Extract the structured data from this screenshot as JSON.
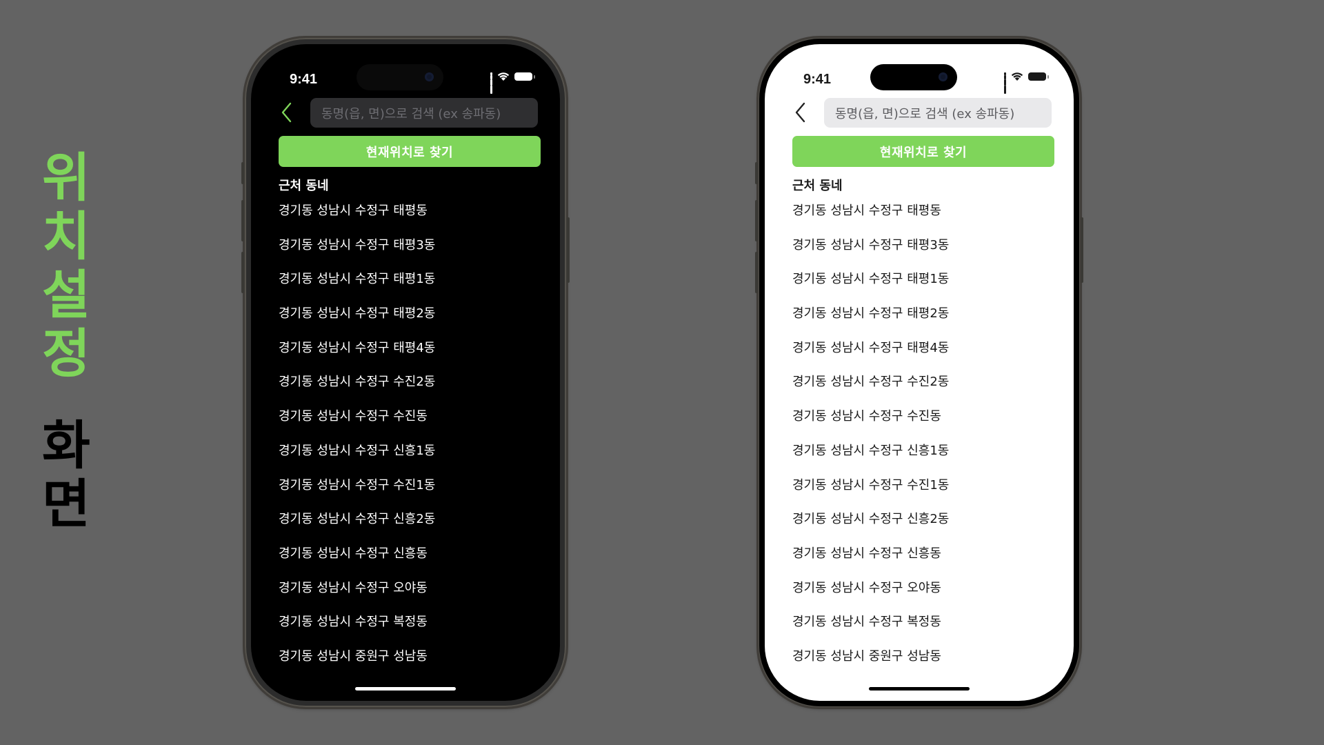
{
  "title": {
    "highlight_chars": [
      "위",
      "치",
      "설",
      "정"
    ],
    "normal_chars": [
      "화",
      "면"
    ]
  },
  "colors": {
    "accent": "#7fd55a",
    "background": "#636363"
  },
  "phones": {
    "dark": {
      "status": {
        "time": "9:41"
      },
      "icons": [
        "chevron-left-icon",
        "signal-icon",
        "wifi-icon",
        "battery-icon"
      ],
      "search": {
        "placeholder": "동명(읍, 면)으로 검색 (ex 송파동)"
      },
      "locate_button": "현재위치로 찾기",
      "section_title": "근처 동네",
      "items": [
        "경기동 성남시 수정구 태평동",
        "경기동 성남시 수정구 태평3동",
        "경기동 성남시 수정구 태평1동",
        "경기동 성남시 수정구 태평2동",
        "경기동 성남시 수정구 태평4동",
        "경기동 성남시 수정구 수진2동",
        "경기동 성남시 수정구 수진동",
        "경기동 성남시 수정구 신흥1동",
        "경기동 성남시 수정구 수진1동",
        "경기동 성남시 수정구 신흥2동",
        "경기동 성남시 수정구 신흥동",
        "경기동 성남시 수정구 오야동",
        "경기동 성남시 수정구 복정동",
        "경기동 성남시 중원구 성남동"
      ]
    },
    "light": {
      "status": {
        "time": "9:41"
      },
      "icons": [
        "chevron-left-icon",
        "signal-icon",
        "wifi-icon",
        "battery-icon"
      ],
      "search": {
        "placeholder": "동명(읍, 면)으로 검색 (ex 송파동)"
      },
      "locate_button": "현재위치로 찾기",
      "section_title": "근처 동네",
      "items": [
        "경기동 성남시 수정구 태평동",
        "경기동 성남시 수정구 태평3동",
        "경기동 성남시 수정구 태평1동",
        "경기동 성남시 수정구 태평2동",
        "경기동 성남시 수정구 태평4동",
        "경기동 성남시 수정구 수진2동",
        "경기동 성남시 수정구 수진동",
        "경기동 성남시 수정구 신흥1동",
        "경기동 성남시 수정구 수진1동",
        "경기동 성남시 수정구 신흥2동",
        "경기동 성남시 수정구 신흥동",
        "경기동 성남시 수정구 오야동",
        "경기동 성남시 수정구 복정동",
        "경기동 성남시 중원구 성남동"
      ]
    }
  }
}
